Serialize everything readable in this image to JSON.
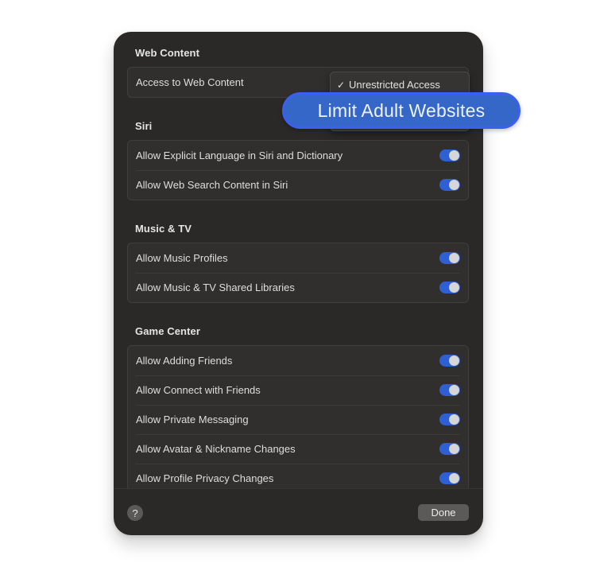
{
  "sections": {
    "web_content": {
      "title": "Web Content",
      "rows": [
        {
          "label": "Access to Web Content",
          "control": "dropdown"
        }
      ],
      "dropdown": {
        "selected": "Unrestricted Access",
        "check_icon": "checkmark-icon",
        "check_glyph": "✓",
        "highlighted_option": "Limit Adult Websites"
      }
    },
    "siri": {
      "title": "Siri",
      "rows": [
        {
          "label": "Allow Explicit Language in Siri and Dictionary",
          "enabled": true
        },
        {
          "label": "Allow Web Search Content in Siri",
          "enabled": true
        }
      ]
    },
    "music_tv": {
      "title": "Music & TV",
      "rows": [
        {
          "label": "Allow Music Profiles",
          "enabled": true
        },
        {
          "label": "Allow Music & TV Shared Libraries",
          "enabled": true
        }
      ]
    },
    "game_center": {
      "title": "Game Center",
      "rows": [
        {
          "label": "Allow Adding Friends",
          "enabled": true
        },
        {
          "label": "Allow Connect with Friends",
          "enabled": true
        },
        {
          "label": "Allow Private Messaging",
          "enabled": true
        },
        {
          "label": "Allow Avatar & Nickname Changes",
          "enabled": true
        },
        {
          "label": "Allow Profile Privacy Changes",
          "enabled": true
        }
      ]
    }
  },
  "footer": {
    "help_glyph": "?",
    "done_label": "Done"
  },
  "colors": {
    "sheet_background": "#2a2928",
    "toggle_on": "#2e5fd3",
    "callout_fill": "#3467c8",
    "callout_border": "#3c5ff0"
  }
}
